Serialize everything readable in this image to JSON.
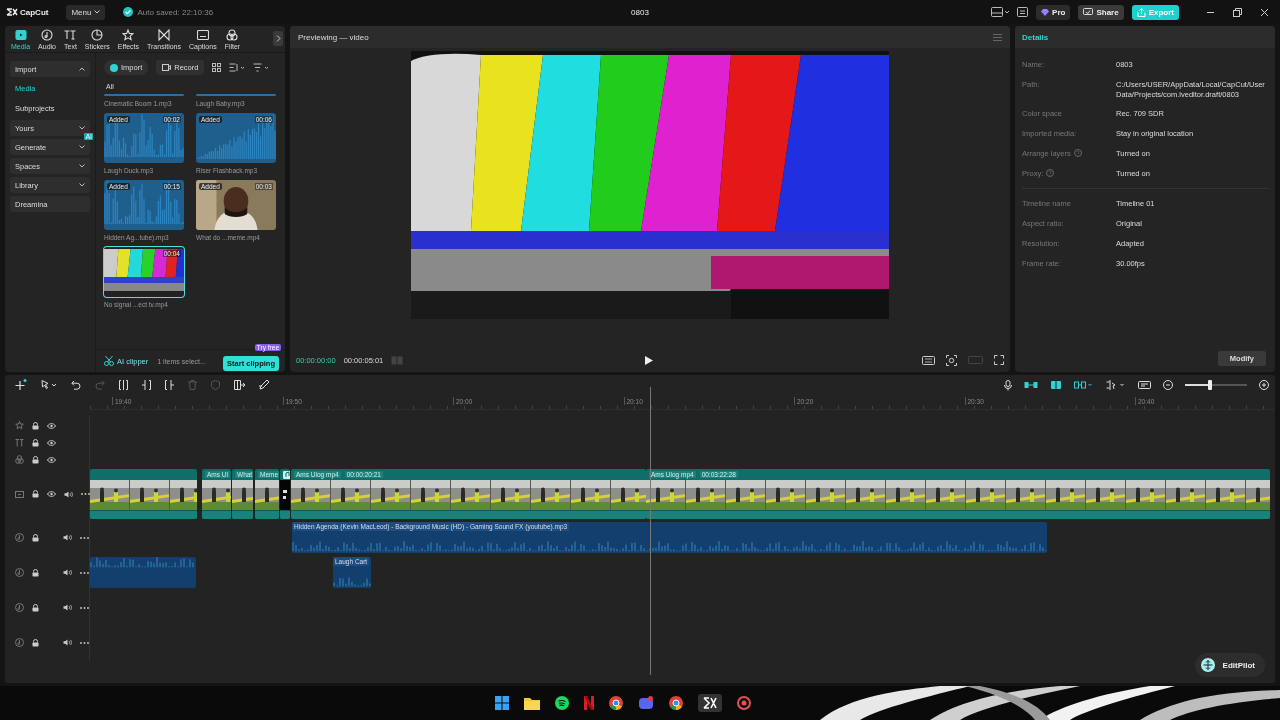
{
  "app": {
    "logo": "CapCut",
    "menu": "Menu",
    "autosave": "Auto saved: 22:10:36",
    "project_title": "0803",
    "pro": "Pro",
    "share": "Share",
    "export": "Export"
  },
  "tabs": [
    {
      "label": "Media",
      "selected": true
    },
    {
      "label": "Audio",
      "selected": false
    },
    {
      "label": "Text",
      "selected": false
    },
    {
      "label": "Stickers",
      "selected": false
    },
    {
      "label": "Effects",
      "selected": false
    },
    {
      "label": "Transitions",
      "selected": false
    },
    {
      "label": "Captions",
      "selected": false
    },
    {
      "label": "Filter",
      "selected": false
    }
  ],
  "sidebar": [
    {
      "label": "Import",
      "kind": "group",
      "expanded": true
    },
    {
      "label": "Media",
      "kind": "sub",
      "selected": true
    },
    {
      "label": "Subprojects",
      "kind": "sub",
      "selected": false
    },
    {
      "label": "Yours",
      "kind": "group",
      "expanded": false
    },
    {
      "label": "Generate",
      "kind": "group",
      "expanded": false,
      "badge": "AI"
    },
    {
      "label": "Spaces",
      "kind": "group",
      "expanded": false
    },
    {
      "label": "Library",
      "kind": "group",
      "expanded": false
    },
    {
      "label": "Dreamina",
      "kind": "plain"
    }
  ],
  "media_toolbar": {
    "import": "Import",
    "record": "Record"
  },
  "media_filter": "All",
  "media_items": [
    {
      "name": "Cinematic Boom 1.mp3",
      "kind": "audio",
      "clipped": true,
      "selected": false
    },
    {
      "name": "Laugh Baby.mp3",
      "kind": "audio",
      "clipped": true,
      "selected": false
    },
    {
      "name": "Laugh Duck.mp3",
      "kind": "audio",
      "clipped": false,
      "added": "Added",
      "duration": "00:02",
      "selected": false
    },
    {
      "name": "Riser Flashback.mp3",
      "kind": "audio",
      "clipped": false,
      "added": "Added",
      "duration": "00:06",
      "selected": false
    },
    {
      "name": "Hidden Ag...tube).mp3",
      "kind": "audio",
      "clipped": false,
      "added": "Added",
      "duration": "00:15",
      "selected": false
    },
    {
      "name": "What do ...meme.mp4",
      "kind": "person",
      "clipped": false,
      "added": "Added",
      "duration": "00:03",
      "selected": false
    },
    {
      "name": "No signal ...ect tv.mp4",
      "kind": "bars",
      "clipped": false,
      "duration": "00:04",
      "selected": true
    }
  ],
  "media_footer": {
    "ai_clipper": "AI clipper",
    "selection": "1 items select...",
    "start": "Start clipping",
    "try_badge": "Try free"
  },
  "preview": {
    "title": "Previewing — video",
    "current_time": "00:00:00:00",
    "total_time": "00:00:05:01"
  },
  "details": {
    "title": "Details",
    "groups": [
      [
        {
          "label": "Name:",
          "value": "0803",
          "help": false
        },
        {
          "label": "Path:",
          "value": "C:/Users/USER/AppData/Local/CapCut/User Data/Projects/com.lveditor.draft/0803",
          "help": false
        },
        {
          "label": "Color space",
          "value": "Rec. 709 SDR",
          "help": false
        },
        {
          "label": "Imported media:",
          "value": "Stay in original location",
          "help": false
        },
        {
          "label": "Arrange layers",
          "value": "Turned on",
          "help": true
        },
        {
          "label": "Proxy:",
          "value": "Turned on",
          "help": true
        }
      ],
      [
        {
          "label": "Timeline name",
          "value": "Timeline 01",
          "help": false
        },
        {
          "label": "Aspect ratio:",
          "value": "Original",
          "help": false
        },
        {
          "label": "Resolution:",
          "value": "Adapted",
          "help": false
        },
        {
          "label": "Frame rate:",
          "value": "30.00fps",
          "help": false
        }
      ]
    ],
    "button": "Modify"
  },
  "zoom_slider": {
    "level": 0.4
  },
  "ruler": [
    "19:40",
    "19:50",
    "20:00",
    "20:10",
    "20:20",
    "20:30",
    "20:40"
  ],
  "tracks": [
    {
      "kind": "effect"
    },
    {
      "kind": "text"
    },
    {
      "kind": "filter"
    },
    {
      "kind": "main",
      "clips": [
        {
          "kind": "video"
        },
        {
          "kind": "video",
          "label": "Ams Ul"
        },
        {
          "kind": "video",
          "label": "What"
        },
        {
          "kind": "video",
          "label": "Meme"
        },
        {
          "kind": "compound"
        },
        {
          "kind": "video",
          "label": "Ams Ulog mp4",
          "duration": "00:00:20:21"
        },
        {
          "kind": "video",
          "label": "Ams Ulog mp4",
          "duration": "00:03:22:28"
        }
      ]
    },
    {
      "kind": "audio",
      "clips": [
        {
          "kind": "audio",
          "label": "Hidden Agenda (Kevin MacLeod) - Background Music (HD) - Gaming Sound FX (youtube).mp3"
        }
      ]
    },
    {
      "kind": "audio",
      "clips": [
        {
          "kind": "audio"
        },
        {
          "kind": "audio",
          "label": "Laugh Cart"
        }
      ]
    },
    {
      "kind": "audio"
    },
    {
      "kind": "audio"
    }
  ],
  "assistant": "EditPilot"
}
